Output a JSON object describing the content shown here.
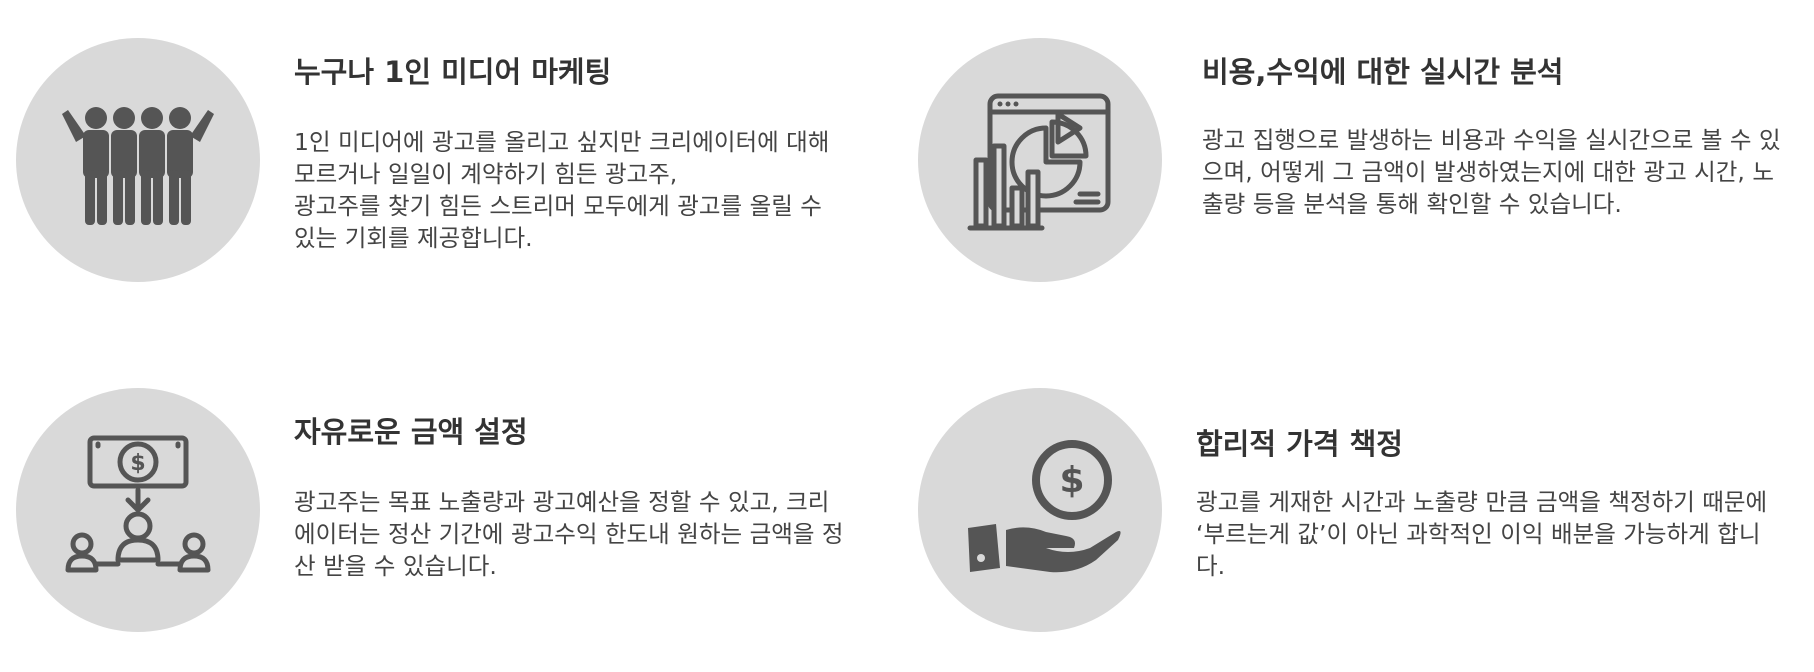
{
  "features": [
    {
      "icon": "people-group-icon",
      "title": "누구나 1인 미디어 마케팅",
      "lines": [
        "1인 미디어에 광고를 올리고 싶지만 크리에이터에 대해",
        "모르거나 일일이 계약하기 힘든 광고주,",
        "광고주를 찾기 힘든 스트리머 모두에게 광고를 올릴 수",
        "있는 기회를 제공합니다."
      ]
    },
    {
      "icon": "analytics-chart-icon",
      "title": "비용,수익에 대한 실시간 분석",
      "lines": [
        "광고 집행으로 발생하는 비용과 수익을 실시간으로 볼 수 있",
        "으며, 어떻게 그 금액이 발생하였는지에 대한 광고 시간, 노",
        "출량 등을 분석을 통해 확인할 수 있습니다."
      ]
    },
    {
      "icon": "money-distribution-icon",
      "title": "자유로운 금액 설정",
      "lines": [
        "광고주는 목표 노출량과 광고예산을 정할 수 있고, 크리",
        "에이터는 정산 기간에 광고수익 한도내 원하는 금액을 정",
        "산 받을 수 있습니다."
      ]
    },
    {
      "icon": "hand-coin-icon",
      "title": "합리적 가격 책정",
      "lines": [
        "광고를 게재한 시간과 노출량 만큼 금액을 책정하기 때문에",
        "‘부르는게 값’이 아닌 과학적인 이익 배분을 가능하게 합니",
        "다."
      ]
    }
  ],
  "colors": {
    "circle": "#d9d9d9",
    "icon": "#555555",
    "title": "#333333",
    "text": "#444444"
  }
}
